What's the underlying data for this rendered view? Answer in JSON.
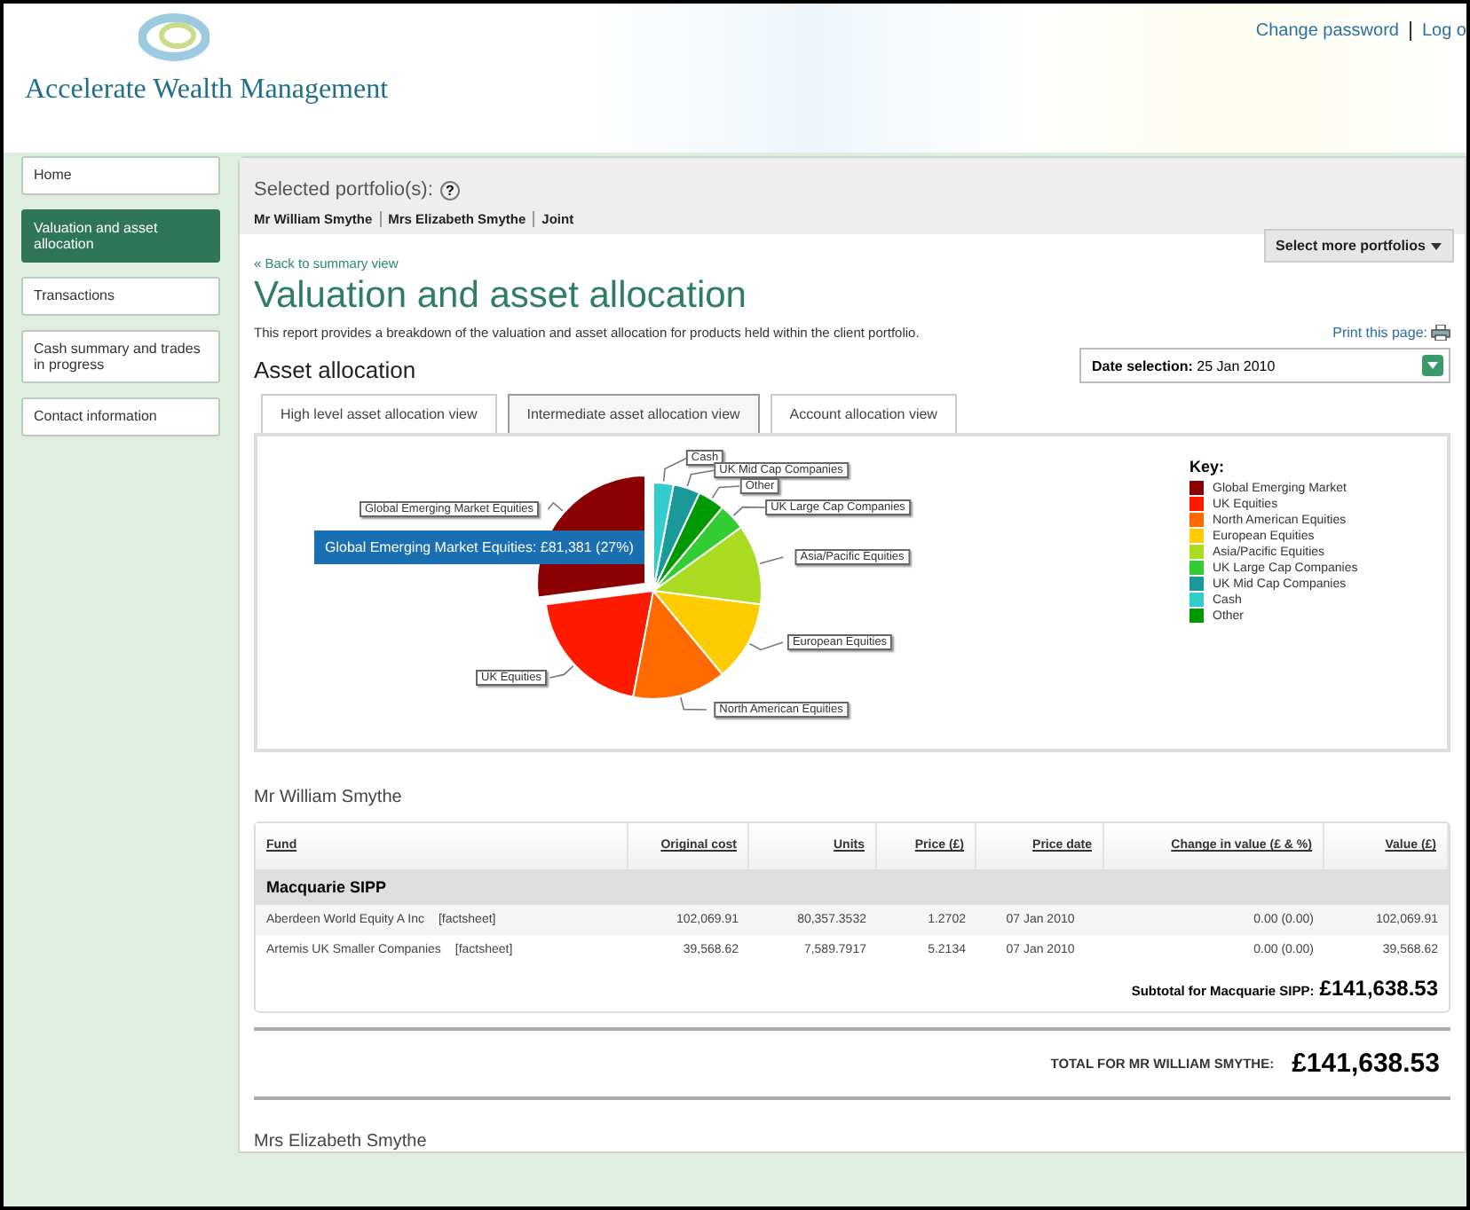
{
  "header": {
    "brand": "Accelerate Wealth Management",
    "links": [
      "Change password",
      "Log o"
    ]
  },
  "sidebar": {
    "items": [
      {
        "label": "Home",
        "selected": false
      },
      {
        "label": "Valuation and asset allocation",
        "selected": true
      },
      {
        "label": "Transactions",
        "selected": false
      },
      {
        "label": "Cash summary and trades in progress",
        "selected": false
      },
      {
        "label": "Contact information",
        "selected": false
      }
    ]
  },
  "portfolios": {
    "label": "Selected portfolio(s):",
    "help": "?",
    "names": [
      "Mr William Smythe",
      "Mrs Elizabeth Smythe",
      "Joint"
    ],
    "more_button": "Select more portfolios"
  },
  "back_link": "« Back to summary view",
  "title": "Valuation and asset allocation",
  "description": "This report provides a breakdown of the valuation and asset allocation for products held within the client portfolio.",
  "print_link": "Print this page:",
  "section_title": "Asset allocation",
  "date_selection": {
    "label": "Date selection:",
    "value": "25 Jan 2010"
  },
  "tabs": [
    {
      "label": "High level asset allocation view",
      "selected": false
    },
    {
      "label": "Intermediate asset allocation view",
      "selected": true
    },
    {
      "label": "Account allocation view",
      "selected": false
    }
  ],
  "chart": {
    "slices": [
      {
        "label": "Cash",
        "color": "#33cccc"
      },
      {
        "label": "UK Mid Cap Companies",
        "color": "#1a9999"
      },
      {
        "label": "Other",
        "color": "#009900"
      },
      {
        "label": "UK Large Cap Companies",
        "color": "#33cc33"
      },
      {
        "label": "Asia/Pacific Equities",
        "color": "#aadd22"
      },
      {
        "label": "European Equities",
        "color": "#ffcc00"
      },
      {
        "label": "North American Equities",
        "color": "#ff6a00"
      },
      {
        "label": "UK Equities",
        "color": "#ff1a00"
      },
      {
        "label": "Global Emerging Market Equities",
        "color": "#8b0000"
      }
    ],
    "tooltip": "Global Emerging Market Equities: £81,381 (27%)",
    "key_title": "Key:",
    "key": [
      {
        "label": "Global Emerging Market",
        "color": "#8b0000"
      },
      {
        "label": "UK Equities",
        "color": "#ff1a00"
      },
      {
        "label": "North American Equities",
        "color": "#ff6a00"
      },
      {
        "label": "European Equities",
        "color": "#ffcc00"
      },
      {
        "label": "Asia/Pacific Equities",
        "color": "#aadd22"
      },
      {
        "label": "UK Large Cap Companies",
        "color": "#33cc33"
      },
      {
        "label": "UK Mid Cap Companies",
        "color": "#1a9999"
      },
      {
        "label": "Cash",
        "color": "#33cccc"
      },
      {
        "label": "Other",
        "color": "#009900"
      }
    ]
  },
  "investor": "Mr William Smythe",
  "table": {
    "columns": [
      "Fund",
      "Original cost",
      "Units",
      "Price (£)",
      "Price date",
      "Change in value (£ & %)",
      "Value (£)"
    ],
    "groups": [
      {
        "name": "Macquarie SIPP",
        "rows": [
          {
            "fund": "Aberdeen World Equity A Inc",
            "link": "[factsheet]",
            "cells": [
              "102,069.91",
              "80,357.3532",
              "1.2702",
              "07 Jan 2010",
              "0.00 (0.00)",
              "102,069.91"
            ]
          },
          {
            "fund": "Artemis UK Smaller Companies",
            "link": "[factsheet]",
            "cells": [
              "39,568.62",
              "7,589.7917",
              "5.2134",
              "07 Jan 2010",
              "0.00 (0.00)",
              "39,568.62"
            ]
          }
        ],
        "subtotal_label": "Subtotal for Macquarie SIPP:",
        "subtotal": "£141,638.53"
      }
    ]
  },
  "total": {
    "label": "TOTAL FOR MR WILLIAM SMYTHE:",
    "value": "£141,638.53"
  },
  "next_investor": "Mrs Elizabeth Smythe"
}
